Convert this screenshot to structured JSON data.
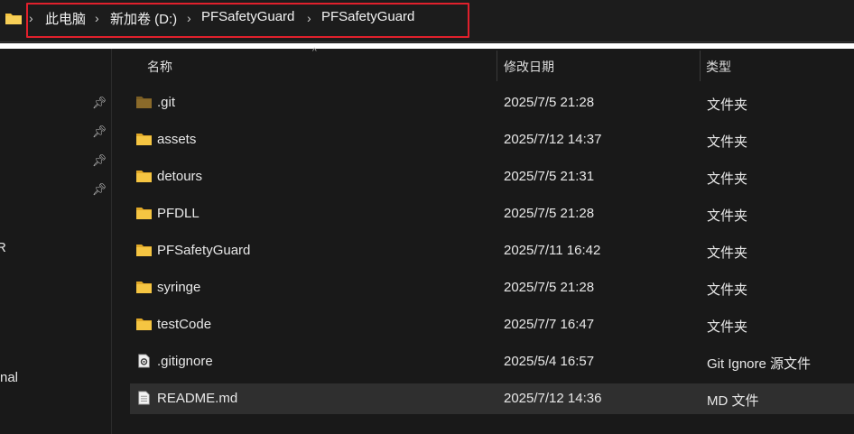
{
  "breadcrumb": {
    "items": [
      "此电脑",
      "新加卷 (D:)",
      "PFSafetyGuard",
      "PFSafetyGuard"
    ]
  },
  "sidebar": {
    "fragments": [
      "R",
      "nal"
    ]
  },
  "columns": {
    "name": "名称",
    "modified": "修改日期",
    "type": "类型"
  },
  "files": [
    {
      "name": ".git",
      "modified": "2025/7/5 21:28",
      "type": "文件夹",
      "icon": "folder-icon"
    },
    {
      "name": "assets",
      "modified": "2025/7/12 14:37",
      "type": "文件夹",
      "icon": "folder-icon"
    },
    {
      "name": "detours",
      "modified": "2025/7/5 21:31",
      "type": "文件夹",
      "icon": "folder-icon"
    },
    {
      "name": "PFDLL",
      "modified": "2025/7/5 21:28",
      "type": "文件夹",
      "icon": "folder-icon"
    },
    {
      "name": "PFSafetyGuard",
      "modified": "2025/7/11 16:42",
      "type": "文件夹",
      "icon": "folder-icon"
    },
    {
      "name": "syringe",
      "modified": "2025/7/5 21:28",
      "type": "文件夹",
      "icon": "folder-icon"
    },
    {
      "name": "testCode",
      "modified": "2025/7/7 16:47",
      "type": "文件夹",
      "icon": "folder-icon"
    },
    {
      "name": ".gitignore",
      "modified": "2025/5/4 16:57",
      "type": "Git Ignore 源文件",
      "icon": "settings-file-icon"
    },
    {
      "name": "README.md",
      "modified": "2025/7/12 14:36",
      "type": "MD 文件",
      "icon": "document-icon"
    }
  ],
  "colors": {
    "folder": "#f5c542",
    "folder_dim": "#8a6a2a",
    "highlight_border": "#e0202c",
    "selected_row": "#2f2f2f"
  }
}
